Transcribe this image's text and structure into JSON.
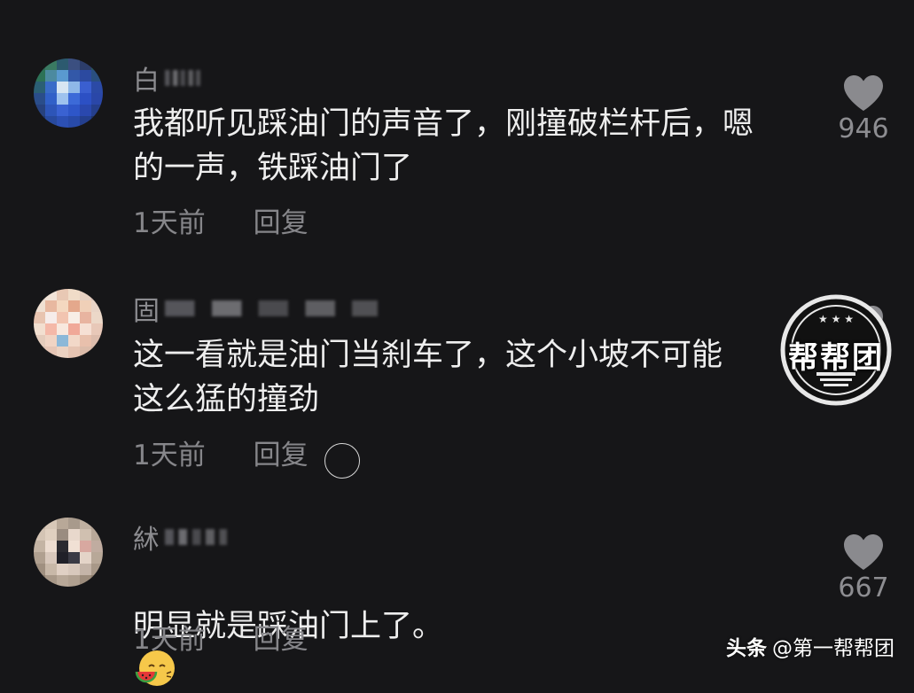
{
  "comments": [
    {
      "username": "白",
      "text": "我都听见踩油门的声音了，刚撞破栏杆后，嗯\n的一声，铁踩油门了",
      "time": "1天前",
      "reply": "回复",
      "likes": "946"
    },
    {
      "username": "固",
      "text": "这一看就是油门当刹车了，这个小坡不可能\n这么猛的撞劲",
      "time": "1天前",
      "reply": "回复",
      "likes": ""
    },
    {
      "username": "絉",
      "text": "明显就是踩油门上了。",
      "time": "1天前",
      "reply": "回复",
      "likes": "667"
    }
  ],
  "seal": {
    "text": "帮帮团"
  },
  "watermark": {
    "brand": "头条",
    "handle": "@第一帮帮团"
  },
  "colors": {
    "background": "#161618",
    "text_primary": "#eeeeee",
    "text_secondary": "#86868a",
    "heart": "#8a8a8e"
  },
  "icons": {
    "like": "heart-icon",
    "emoji": "watermelon-face-emoji"
  }
}
